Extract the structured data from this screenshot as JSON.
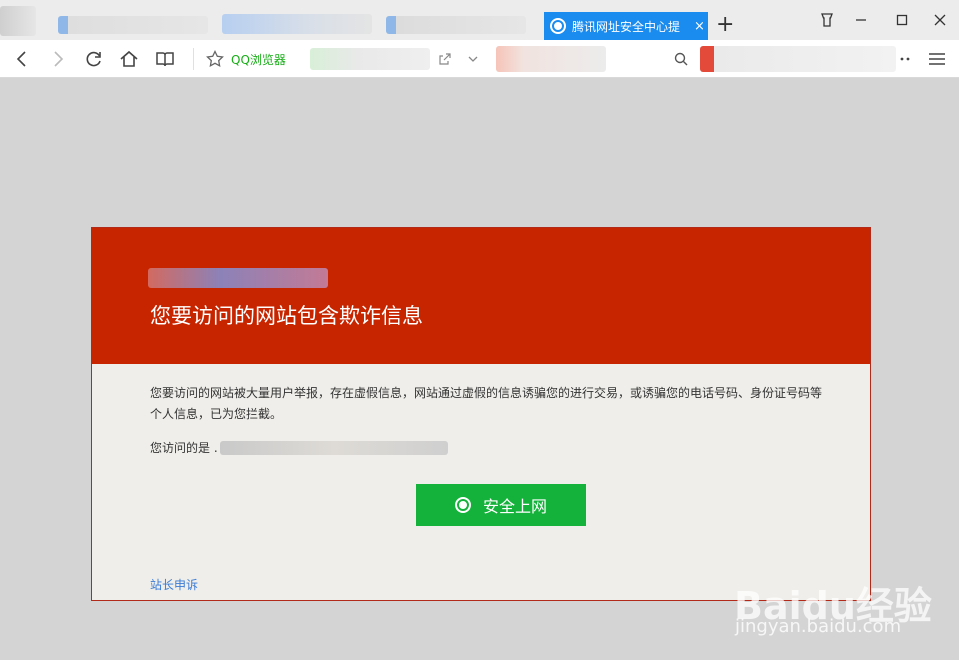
{
  "tabstrip": {
    "active_tab_title": "腾讯网址安全中心提",
    "close_glyph": "×",
    "new_tab_glyph": "+"
  },
  "navbar": {
    "favorite_label": "QQ浏览器"
  },
  "warning": {
    "headline": "您要访问的网站包含欺诈信息",
    "description": "您要访问的网站被大量用户举报，存在虚假信息，网站通过虚假的信息诱骗您的进行交易，或诱骗您的电话号码、身份证号码等个人信息，已为您拦截。",
    "visit_label": "您访问的是 .",
    "safe_button_label": "安全上网",
    "appeal_link": "站长申诉"
  },
  "watermark": {
    "main": "Baidu经验",
    "sub": "jingyan.baidu.com"
  },
  "colors": {
    "header_red": "#c72400",
    "card_bg": "#efeeea",
    "button_green": "#15b23b",
    "tab_blue": "#1a8cf0",
    "link_blue": "#3a7bd5"
  }
}
